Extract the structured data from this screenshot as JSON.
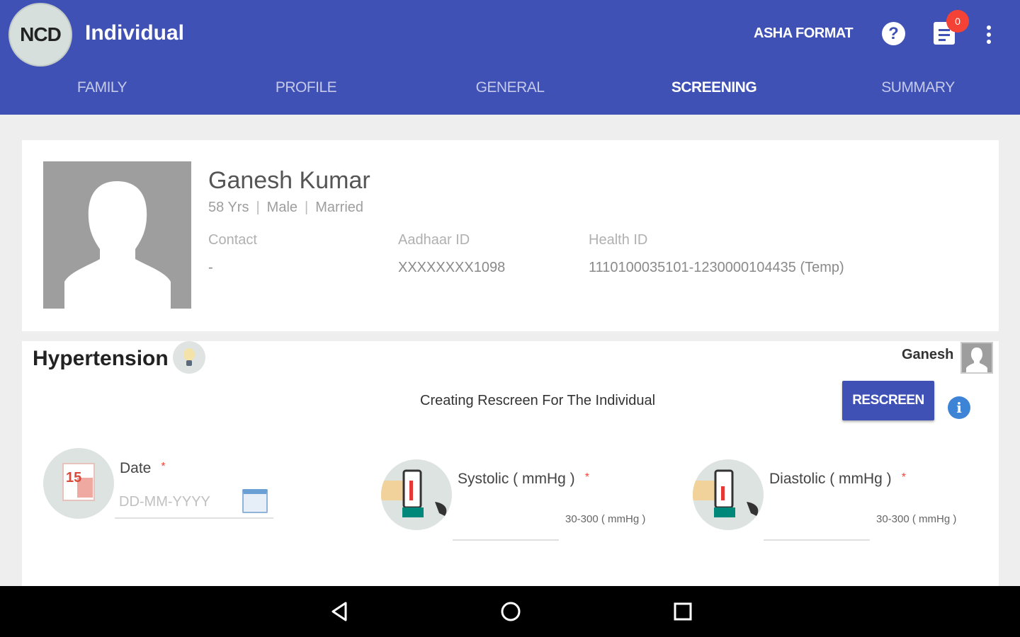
{
  "app": {
    "logo_text": "NCD",
    "title": "Individual",
    "asha_format": "ASHA FORMAT",
    "notification_count": "0",
    "colors": {
      "primary": "#3f51b5",
      "badge": "#f44336"
    }
  },
  "tabs": [
    {
      "label": "FAMILY"
    },
    {
      "label": "PROFILE"
    },
    {
      "label": "GENERAL"
    },
    {
      "label": "SCREENING",
      "active": true
    },
    {
      "label": "SUMMARY"
    }
  ],
  "profile": {
    "name": "Ganesh Kumar",
    "age": "58 Yrs",
    "gender": "Male",
    "marital_status": "Married",
    "separator": "|",
    "contact_label": "Contact",
    "contact_value": "-",
    "aadhaar_label": "Aadhaar ID",
    "aadhaar_value": "XXXXXXXX1098",
    "health_id_label": "Health ID",
    "health_id_value": "1110100035101-1230000104435 (Temp)"
  },
  "screening": {
    "section_title": "Hypertension",
    "user_name": "Ganesh",
    "rescreen_text": "Creating Rescreen For The Individual",
    "rescreen_button": "RESCREEN",
    "info_glyph": "i",
    "date": {
      "icon_text": "15",
      "label": "Date",
      "required_mark": "*",
      "placeholder": "DD-MM-YYYY"
    },
    "systolic": {
      "label": "Systolic ( mmHg )",
      "required_mark": "*",
      "range": "30-300 ( mmHg )"
    },
    "diastolic": {
      "label": "Diastolic ( mmHg )",
      "required_mark": "*",
      "range": "30-300 ( mmHg )"
    }
  },
  "navbar": {
    "icons": [
      "back-icon",
      "home-icon",
      "recents-icon"
    ]
  }
}
